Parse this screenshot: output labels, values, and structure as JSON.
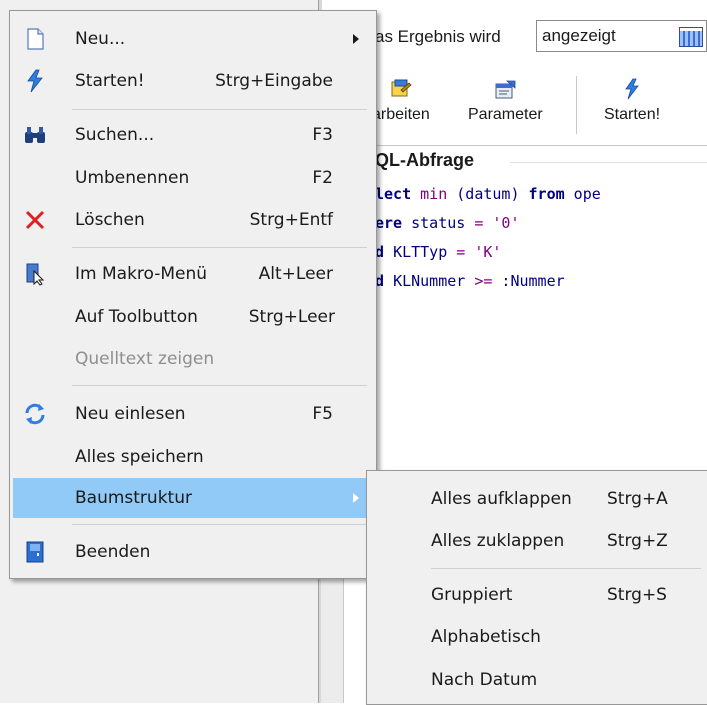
{
  "background": {
    "result_label": "as Ergebnis wird",
    "result_combo_value": "angezeigt",
    "toolbar": [
      {
        "label": "arbeiten",
        "icon": "edit-icon"
      },
      {
        "label": "Parameter",
        "icon": "parameter-icon"
      },
      {
        "label": "Starten!",
        "icon": "lightning-icon"
      }
    ],
    "sql_title": "QL-Abfrage",
    "sql_lines": [
      [
        {
          "t": "lect ",
          "c": "kw"
        },
        {
          "t": "min",
          "c": "fn"
        },
        {
          "t": " (datum) ",
          "c": "plain"
        },
        {
          "t": "from",
          "c": "kw"
        },
        {
          "t": " ope",
          "c": "plain"
        }
      ],
      [
        {
          "t": "ere ",
          "c": "kw"
        },
        {
          "t": "status ",
          "c": "plain"
        },
        {
          "t": "=",
          "c": "op"
        },
        {
          "t": " ",
          "c": "plain"
        },
        {
          "t": "'0'",
          "c": "str"
        }
      ],
      [
        {
          "t": "d ",
          "c": "kw"
        },
        {
          "t": "KLTTyp ",
          "c": "plain"
        },
        {
          "t": "=",
          "c": "op"
        },
        {
          "t": " ",
          "c": "plain"
        },
        {
          "t": "'K'",
          "c": "str"
        }
      ],
      [
        {
          "t": "d ",
          "c": "kw"
        },
        {
          "t": "KLNummer ",
          "c": "plain"
        },
        {
          "t": ">=",
          "c": "op"
        },
        {
          "t": " :Nummer",
          "c": "plain"
        }
      ]
    ]
  },
  "menu": {
    "items": [
      {
        "label": "Neu...",
        "shortcut": "",
        "icon": "new-document-icon",
        "submenu": true
      },
      {
        "label": "Starten!",
        "shortcut": "Strg+Eingabe",
        "icon": "lightning-icon"
      },
      {
        "label": "Suchen...",
        "shortcut": "F3",
        "icon": "binoculars-icon"
      },
      {
        "label": "Umbenennen",
        "shortcut": "F2",
        "icon": ""
      },
      {
        "label": "Löschen",
        "shortcut": "Strg+Entf",
        "icon": "delete-x-icon"
      },
      {
        "label": "Im Makro-Menü",
        "shortcut": "Alt+Leer",
        "icon": "macro-menu-icon"
      },
      {
        "label": "Auf Toolbutton",
        "shortcut": "Strg+Leer",
        "icon": ""
      },
      {
        "label": "Quelltext zeigen",
        "shortcut": "",
        "icon": "",
        "disabled": true
      },
      {
        "label": "Neu einlesen",
        "shortcut": "F5",
        "icon": "refresh-icon"
      },
      {
        "label": "Alles speichern",
        "shortcut": "",
        "icon": ""
      },
      {
        "label": "Baumstruktur",
        "shortcut": "",
        "icon": "",
        "submenu": true,
        "highlighted": true
      },
      {
        "label": "Beenden",
        "shortcut": "",
        "icon": "exit-door-icon"
      }
    ]
  },
  "submenu": {
    "items": [
      {
        "label": "Alles aufklappen",
        "shortcut": "Strg+A"
      },
      {
        "label": "Alles zuklappen",
        "shortcut": "Strg+Z"
      },
      {
        "label": "Gruppiert",
        "shortcut": "Strg+S"
      },
      {
        "label": "Alphabetisch",
        "shortcut": ""
      },
      {
        "label": "Nach Datum",
        "shortcut": ""
      }
    ]
  },
  "colors": {
    "highlight": "#91c9f7",
    "menu_bg": "#f0f0f0",
    "disabled_text": "#8e8e8e",
    "sql_keyword": "#000080",
    "sql_string": "#800080"
  }
}
